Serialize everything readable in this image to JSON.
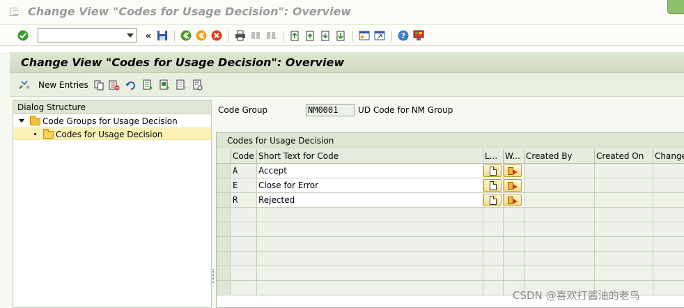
{
  "window": {
    "title": "Change View \"Codes for Usage Decision\": Overview"
  },
  "std_toolbar": {
    "command_field_value": "",
    "icons": [
      "enter-icon",
      "save-icon",
      "back-icon",
      "exit-icon",
      "cancel-icon",
      "print-icon",
      "find-icon",
      "find-next-icon",
      "first-page-icon",
      "previous-page-icon",
      "next-page-icon",
      "last-page-icon",
      "create-session-icon",
      "shortcut-icon",
      "help-icon",
      "customize-layout-icon"
    ]
  },
  "screen": {
    "title": "Change View \"Codes for Usage Decision\": Overview"
  },
  "app_toolbar": {
    "new_entries_label": "New Entries"
  },
  "dialog_structure": {
    "header": "Dialog Structure",
    "items": [
      {
        "label": "Code Groups for Usage Decision",
        "level": 0,
        "expanded": true,
        "selected": false
      },
      {
        "label": "Codes for Usage Decision",
        "level": 1,
        "expanded": false,
        "selected": true
      }
    ]
  },
  "code_group": {
    "label": "Code Group",
    "value": "NM0001",
    "description": "UD Code for NM Group"
  },
  "table": {
    "title": "Codes for Usage Decision",
    "columns": [
      "Code",
      "Short Text for Code",
      "L...",
      "W...",
      "Created By",
      "Created On",
      "Change"
    ],
    "rows": [
      {
        "code": "A",
        "short_text": "Accept",
        "created_by": "",
        "created_on": ""
      },
      {
        "code": "E",
        "short_text": "Close for Error",
        "created_by": "",
        "created_on": ""
      },
      {
        "code": "R",
        "short_text": "Rejected",
        "created_by": "",
        "created_on": ""
      }
    ],
    "empty_rows": 6
  },
  "watermark": "CSDN @喜欢打酱油的老鸟"
}
